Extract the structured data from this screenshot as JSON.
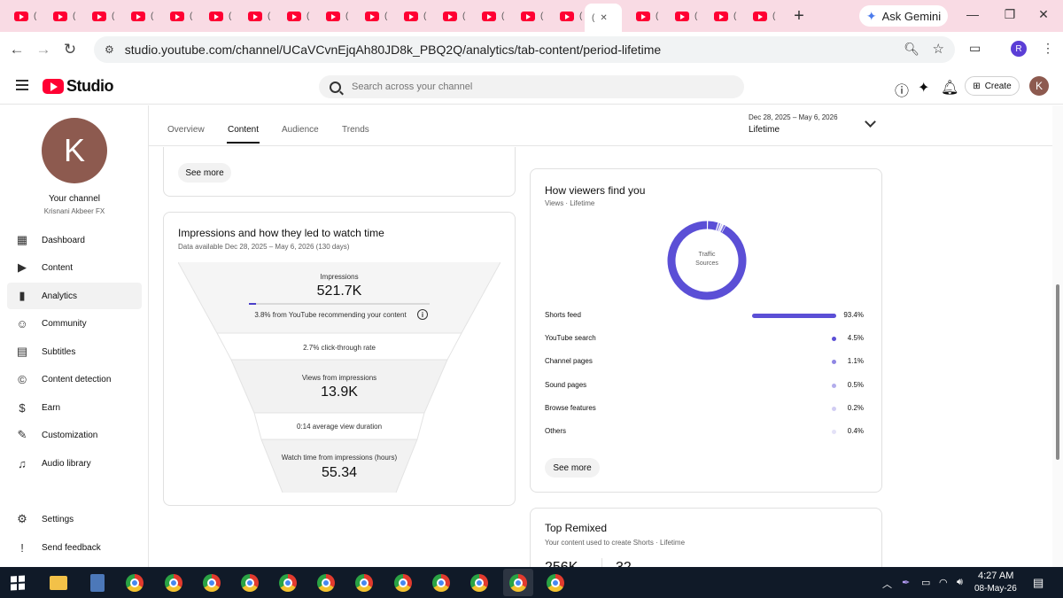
{
  "browser": {
    "tab_count": 20,
    "new_tab_glyph": "+",
    "ask_gemini": "Ask Gemini",
    "url": "studio.youtube.com/channel/UCaVCvnEjqAh80JD8k_PBQ2Q/analytics/tab-content/period-lifetime",
    "profile_initial": "R"
  },
  "studio": {
    "logo_text": "Studio",
    "search_placeholder": "Search across your channel",
    "create_label": "Create",
    "avatar_initial": "K"
  },
  "sidebar": {
    "avatar_initial": "K",
    "your_channel": "Your channel",
    "channel_name": "Krisnani Akbeer FX",
    "items": [
      {
        "label": "Dashboard",
        "icon": "dashboard-icon",
        "glyph": "▦"
      },
      {
        "label": "Content",
        "icon": "content-icon",
        "glyph": "▶"
      },
      {
        "label": "Analytics",
        "icon": "analytics-icon",
        "glyph": "▮"
      },
      {
        "label": "Community",
        "icon": "community-icon",
        "glyph": "☺"
      },
      {
        "label": "Subtitles",
        "icon": "subtitles-icon",
        "glyph": "▤"
      },
      {
        "label": "Content detection",
        "icon": "copyright-icon",
        "glyph": "©"
      },
      {
        "label": "Earn",
        "icon": "earn-icon",
        "glyph": "$"
      },
      {
        "label": "Customization",
        "icon": "customization-icon",
        "glyph": "✎"
      },
      {
        "label": "Audio library",
        "icon": "audio-library-icon",
        "glyph": "♫"
      }
    ],
    "bottom_items": [
      {
        "label": "Settings",
        "icon": "settings-icon",
        "glyph": "⚙"
      },
      {
        "label": "Send feedback",
        "icon": "feedback-icon",
        "glyph": "!"
      }
    ]
  },
  "tabs": {
    "items": [
      "Overview",
      "Content",
      "Audience",
      "Trends"
    ],
    "active": "Content",
    "period_range": "Dec 28, 2025 – May 6, 2026",
    "period_label": "Lifetime"
  },
  "top_card": {
    "see_more": "See more"
  },
  "impressions": {
    "title": "Impressions and how they led to watch time",
    "subtitle": "Data available Dec 28, 2025 – May 6, 2026 (130 days)",
    "impressions_label": "Impressions",
    "impressions_value": "521.7K",
    "recommend_fraction": 0.038,
    "recommend_text": "3.8% from YouTube recommending your content",
    "ctr_text": "2.7% click-through rate",
    "views_label": "Views from impressions",
    "views_value": "13.9K",
    "avd_text": "0:14 average view duration",
    "watch_label": "Watch time from impressions (hours)",
    "watch_value": "55.34"
  },
  "traffic": {
    "title": "How viewers find you",
    "subtitle": "Views · Lifetime",
    "donut_label_1": "Traffic",
    "donut_label_2": "Sources",
    "accent": "#5b4fd6",
    "sources": [
      {
        "name": "Shorts feed",
        "pct_text": "93.4%",
        "value": 93.4,
        "color": "#5b4fd6"
      },
      {
        "name": "YouTube search",
        "pct_text": "4.5%",
        "value": 4.5,
        "color": "#5b4fd6"
      },
      {
        "name": "Channel pages",
        "pct_text": "1.1%",
        "value": 1.1,
        "color": "#8f86e3"
      },
      {
        "name": "Sound pages",
        "pct_text": "0.5%",
        "value": 0.5,
        "color": "#b3adec"
      },
      {
        "name": "Browse features",
        "pct_text": "0.2%",
        "value": 0.2,
        "color": "#d1cdf3"
      },
      {
        "name": "Others",
        "pct_text": "0.4%",
        "value": 0.4,
        "color": "#e3e1f7"
      }
    ],
    "see_more": "See more"
  },
  "remixed": {
    "title": "Top Remixed",
    "subtitle": "Your content used to create Shorts · Lifetime",
    "stat_1": "256K",
    "stat_2": "32"
  },
  "taskbar": {
    "time": "4:27 AM",
    "date": "08-May-26"
  }
}
